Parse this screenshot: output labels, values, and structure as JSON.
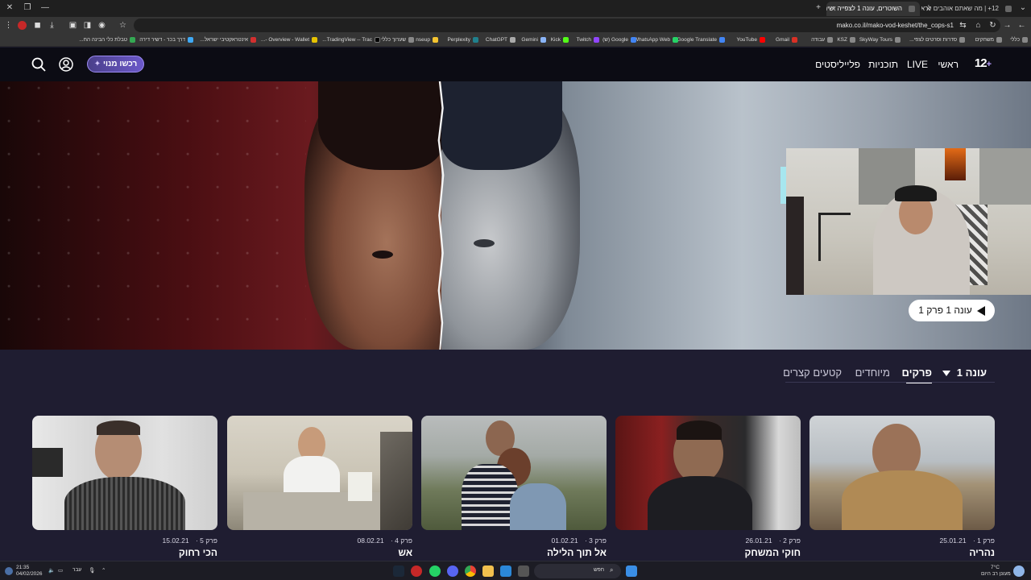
{
  "browser": {
    "tabs": [
      {
        "title": "12+ | מה שאתם אוהבים לראות",
        "active": false
      },
      {
        "title": "השוטרים, עונה 1 לצפייה ישירה",
        "active": true
      }
    ],
    "url": "mako.co.il/mako-vod-keshet/the_cops-s1",
    "bookmarks": [
      "כללי",
      "משחקים",
      "סדרות וסרטים לצפי...",
      "SkyWay Tours",
      "KSZ",
      "עבודה",
      "Gmail",
      "YouTube",
      "Google Translate",
      "WhatsApp Web",
      "Google (ש)",
      "Twitch",
      "Kick",
      "Gemini",
      "ChatGPT",
      "Perplexity",
      "nseup",
      "שערוך כללי",
      "TradingView -- Trac...",
      "Overview - Wallet -...",
      "אינטראקטיבי ישראל...",
      "דרך בכר - דשיר דירה",
      "טבלת כלי הבינה הח..."
    ]
  },
  "site": {
    "logo": "12",
    "logo_plus": "+",
    "nav": [
      "ראשי",
      "LIVE",
      "תוכניות",
      "פלייליסטים"
    ],
    "cta_label": "רכשו מנוי"
  },
  "hero": {
    "play_label": "עונה 1 פרק 1"
  },
  "content": {
    "season_label": "עונה 1",
    "tabs": [
      {
        "label": "פרקים",
        "active": true
      },
      {
        "label": "מיוחדים",
        "active": false
      },
      {
        "label": "קטעים קצרים",
        "active": false
      }
    ],
    "episodes": [
      {
        "meta": "פרק 1",
        "date": "25.01.21",
        "title": "נהריה"
      },
      {
        "meta": "פרק 2",
        "date": "26.01.21",
        "title": "חוקי המשחק"
      },
      {
        "meta": "פרק 3",
        "date": "01.02.21",
        "title": "אל תוך הלילה"
      },
      {
        "meta": "פרק 4",
        "date": "08.02.21",
        "title": "אש"
      },
      {
        "meta": "פרק 5",
        "date": "15.02.21",
        "title": "הכי רחוק"
      }
    ]
  },
  "taskbar": {
    "search_placeholder": "חפש",
    "lang": "עבר",
    "time": "21:35",
    "date": "04/02/2026",
    "weather_temp": "7°C",
    "weather_desc": "מעונן רב היום"
  },
  "colors": {
    "accent": "#6b58c9",
    "background": "#1f1d31",
    "header": "#0c0c14"
  }
}
